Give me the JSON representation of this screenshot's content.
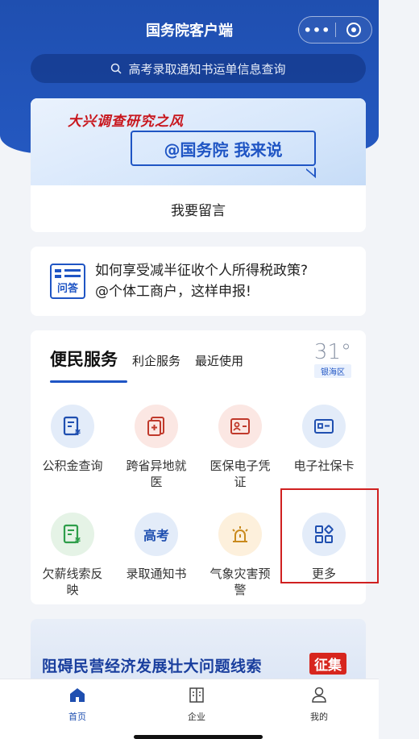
{
  "header": {
    "title": "国务院客户端",
    "capsule_more": "•••",
    "search_placeholder": "高考录取通知书运单信息查询"
  },
  "banner": {
    "slogan": "大兴调查研究之风",
    "cta": "@国务院 我来说",
    "leave_message": "我要留言"
  },
  "qa": {
    "icon_label": "问答",
    "line1": "如何享受减半征收个人所得税政策?",
    "line2": "@个体工商户，这样申报!"
  },
  "services": {
    "tabs": [
      "便民服务",
      "利企服务",
      "最近使用"
    ],
    "weather": {
      "temp": "31°",
      "location": "银海区"
    },
    "items": [
      {
        "label": "公积金查询",
        "icon": "fund-doc-icon",
        "color": "blue"
      },
      {
        "label": "跨省异地就医",
        "icon": "medical-doc-icon",
        "color": "red"
      },
      {
        "label": "医保电子凭证",
        "icon": "id-card-icon",
        "color": "red"
      },
      {
        "label": "电子社保卡",
        "icon": "social-card-icon",
        "color": "blue"
      },
      {
        "label": "欠薪线索反映",
        "icon": "wage-doc-icon",
        "color": "green"
      },
      {
        "label": "录取通知书",
        "icon": "gaokao-icon",
        "icon_text": "高考",
        "color": "blue"
      },
      {
        "label": "气象灾害预警",
        "icon": "alarm-icon",
        "color": "orange"
      },
      {
        "label": "更多",
        "icon": "grid-more-icon",
        "color": "blue"
      }
    ]
  },
  "promo": {
    "text": "阻碍民营经济发展壮大问题线索",
    "badge": "征集"
  },
  "tabbar": {
    "items": [
      {
        "label": "首页",
        "icon": "home-icon",
        "active": true
      },
      {
        "label": "企业",
        "icon": "building-icon",
        "active": false
      },
      {
        "label": "我的",
        "icon": "user-icon",
        "active": false
      }
    ]
  },
  "colors": {
    "brand_blue": "#1f4fb0",
    "accent_red": "#c8161d",
    "highlight": "#d02020"
  }
}
